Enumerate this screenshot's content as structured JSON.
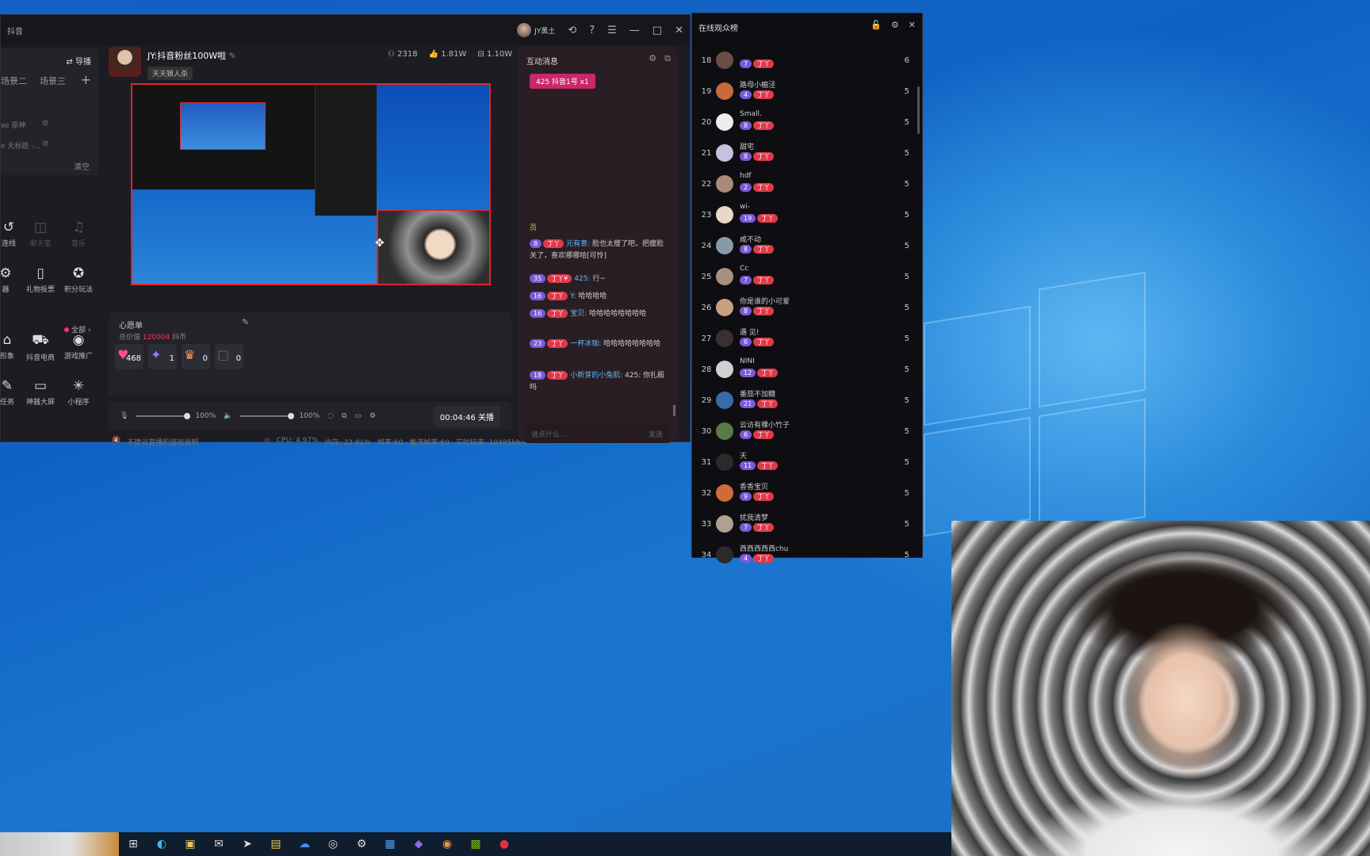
{
  "app": {
    "title": "抖音",
    "user_name": "JY黑土"
  },
  "left": {
    "director_label": "⇄ 导播",
    "scenes": [
      "场景二",
      "场景三"
    ],
    "sources": [
      {
        "label": "xe 原神"
      },
      {
        "label": "e 无标题 -..."
      }
    ],
    "clear_label": "清空",
    "tools_row1": [
      "连线",
      "聊天室",
      "音乐"
    ],
    "tools_row2": [
      "器",
      "礼物投票",
      "积分玩法"
    ],
    "all_label": "全部 ›",
    "tools_row3": [
      "形象",
      "抖音电商",
      "游戏推广"
    ],
    "tools_row4": [
      "任务",
      "神器大屏",
      "小程序"
    ]
  },
  "streamer": {
    "name": "JY:抖音粉丝100W啦",
    "tag": "天天狼人杀"
  },
  "stats": {
    "online": "2318",
    "likes": "1.81W",
    "gifts": "1.10W"
  },
  "wish": {
    "title": "心愿单",
    "total_prefix": "总价值",
    "total_value": "120004",
    "total_unit": "抖币",
    "gifts": [
      {
        "count": "468",
        "icon": "heart-gift"
      },
      {
        "count": "1",
        "icon": "rocket-gift"
      },
      {
        "count": "0",
        "icon": "cake-gift"
      },
      {
        "count": "0",
        "icon": "blank-gift"
      }
    ]
  },
  "controls": {
    "mic_volume": "100%",
    "speaker_volume": "100%",
    "timer": "00:04:46",
    "close_label": "关播"
  },
  "status": {
    "left": "不建议直播的游戏说明",
    "cpu": "CPU: 4.97%",
    "mem": "内存: 22.81%",
    "fps": "帧率:60",
    "push_fps": "推流帧率:60",
    "bitrate": "实时码率: 10495kb/s"
  },
  "interaction": {
    "title": "互动消息",
    "top_badge": "425  抖音1号  x1",
    "messages": [
      {
        "lvl": "",
        "fans": "",
        "nick": "",
        "text": "员"
      },
      {
        "lvl": "8",
        "fans": "丁丫",
        "nick": "元有意:",
        "text": "脸也太瘦了吧，把瘦脸关了，喜欢哪哪哈[可怜]"
      },
      {
        "lvl": "35",
        "fans": "丁丫¥",
        "nick": "425:",
        "text": "行~"
      },
      {
        "lvl": "16",
        "fans": "丁丫",
        "nick": "Y:",
        "text": "哈哈哈哈"
      },
      {
        "lvl": "16",
        "fans": "丁丫",
        "nick": "宝贝:",
        "text": "哈哈哈哈哈哈哈哈"
      },
      {
        "lvl": "23",
        "fans": "丁丫",
        "nick": "一杯冰咖:",
        "text": "哈哈哈哈哈哈哈哈"
      },
      {
        "lvl": "18",
        "fans": "丁丫",
        "nick": "小新芽的小兔肌:",
        "text": "425: 你扎殿吗"
      }
    ],
    "input_placeholder": "说点什么...",
    "send_label": "发送"
  },
  "viewers": {
    "title": "在线观众榜",
    "rows": [
      {
        "rank": "18",
        "name": "",
        "lvl": "7",
        "score": "6",
        "color": "#6a4e44"
      },
      {
        "rank": "19",
        "name": "路母小楣泾",
        "lvl": "4",
        "score": "5",
        "color": "#c86a3a"
      },
      {
        "rank": "20",
        "name": "Small.",
        "lvl": "8",
        "score": "5",
        "color": "#eeeeee"
      },
      {
        "rank": "21",
        "name": "甜宅",
        "lvl": "8",
        "score": "5",
        "color": "#c8c0e0"
      },
      {
        "rank": "22",
        "name": "hdf",
        "lvl": "2",
        "score": "5",
        "color": "#a88a7a"
      },
      {
        "rank": "23",
        "name": "wi-",
        "lvl": "19",
        "score": "5",
        "color": "#e8d8c8"
      },
      {
        "rank": "24",
        "name": "咸不动",
        "lvl": "8",
        "score": "5",
        "color": "#8899aa"
      },
      {
        "rank": "25",
        "name": "Cc",
        "lvl": "7",
        "score": "5",
        "color": "#a89080"
      },
      {
        "rank": "26",
        "name": "你是谁的小可爱",
        "lvl": "8",
        "score": "5",
        "color": "#c8a080"
      },
      {
        "rank": "27",
        "name": "遇 见!",
        "lvl": "6",
        "score": "5",
        "color": "#3a3030"
      },
      {
        "rank": "28",
        "name": "NINI",
        "lvl": "12",
        "score": "5",
        "color": "#d0d0d0"
      },
      {
        "rank": "29",
        "name": "番茄不加糖",
        "lvl": "21",
        "score": "5",
        "color": "#3a6aa8"
      },
      {
        "rank": "30",
        "name": "云访有棵小竹子",
        "lvl": "6",
        "score": "5",
        "color": "#5a7a4a"
      },
      {
        "rank": "31",
        "name": "天",
        "lvl": "11",
        "score": "5",
        "color": "#2a2a2a"
      },
      {
        "rank": "32",
        "name": "香香宝贝",
        "lvl": "9",
        "score": "5",
        "color": "#d06a3a"
      },
      {
        "rank": "33",
        "name": "扰我清梦",
        "lvl": "7",
        "score": "5",
        "color": "#b0a090"
      },
      {
        "rank": "34",
        "name": "西西西西西chu",
        "lvl": "4",
        "score": "5",
        "color": "#2a2a2a"
      }
    ]
  },
  "taskbar": {
    "icons": [
      "task-view",
      "edge",
      "store",
      "mail",
      "feather",
      "explorer",
      "onedrive",
      "obs",
      "steam",
      "app-blue",
      "app-purple",
      "app-orange",
      "nvidia",
      "app-red"
    ]
  }
}
